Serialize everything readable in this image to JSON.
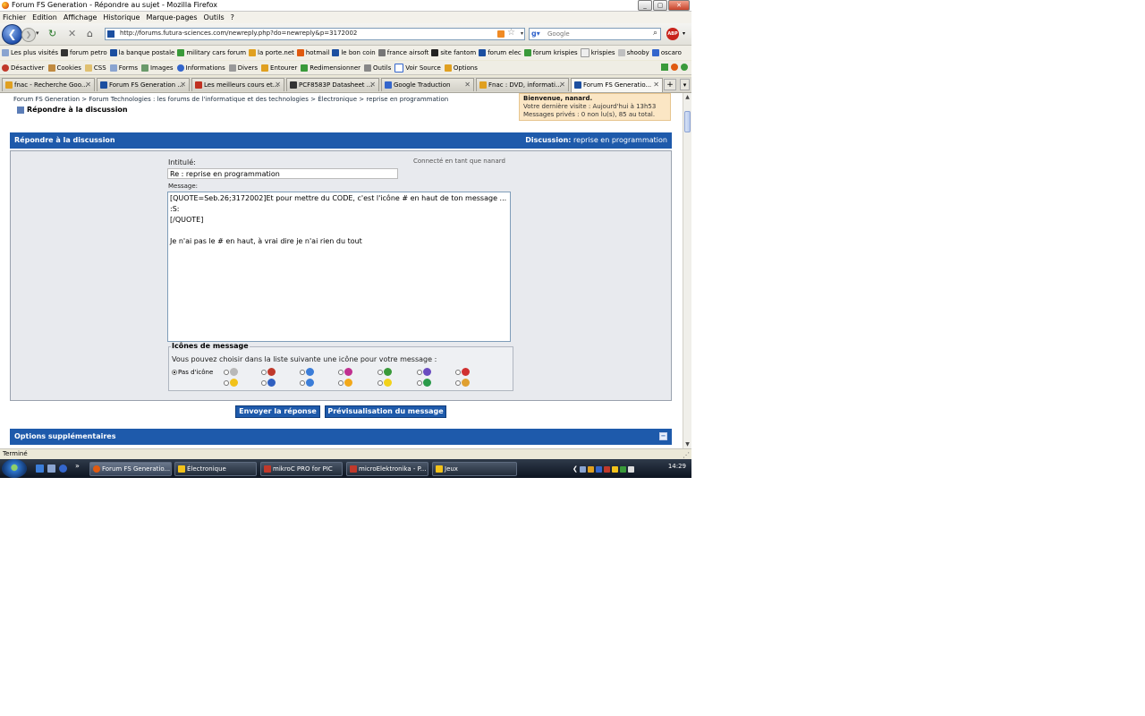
{
  "window": {
    "title": "Forum FS Generation - Répondre au sujet - Mozilla Firefox",
    "controls": [
      "_",
      "▢",
      "✕"
    ]
  },
  "menu": [
    "Fichier",
    "Edition",
    "Affichage",
    "Historique",
    "Marque-pages",
    "Outils",
    "?"
  ],
  "nav": {
    "url": "http://forums.futura-sciences.com/newreply.php?do=newreply&p=3172002",
    "search_placeholder": "Google"
  },
  "bookmarks": [
    "Les plus visités",
    "forum petro",
    "la banque postale",
    "military cars forum",
    "la porte.net",
    "hotmail",
    "le bon coin",
    "france airsoft",
    "site fantom",
    "forum elec",
    "forum krispies",
    "krispies",
    "shooby",
    "oscaro"
  ],
  "devbar": [
    "Désactiver",
    "Cookies",
    "CSS",
    "Forms",
    "Images",
    "Informations",
    "Divers",
    "Entourer",
    "Redimensionner",
    "Outils",
    "Voir Source",
    "Options"
  ],
  "tabs": [
    {
      "label": "fnac - Recherche Goo...",
      "color": "#e0a020"
    },
    {
      "label": "Forum FS Generation ...",
      "color": "#1c4fa0"
    },
    {
      "label": "Les meilleurs cours et...",
      "color": "#c03020"
    },
    {
      "label": "PCF8583P Datasheet ...",
      "color": "#333333"
    },
    {
      "label": "Google Traduction",
      "color": "#3466cc"
    },
    {
      "label": "Fnac : DVD, informati...",
      "color": "#e0a020"
    },
    {
      "label": "Forum FS Generatio...",
      "color": "#1c4fa0"
    }
  ],
  "page": {
    "breadcrumb": "Forum FS Generation > Forum Technologies : les forums de l'informatique et des technologies > Électronique > reprise en programmation",
    "title": "Répondre à la discussion",
    "welcome": {
      "greeting": "Bienvenue, nanard.",
      "last_visit": "Votre dernière visite : Aujourd'hui à 13h53",
      "private": "Messages privés : 0 non lu(s), 85 au total."
    },
    "panel": {
      "heading": "Répondre à la discussion",
      "discussion_label": "Discussion:",
      "discussion_value": "reprise en programmation"
    },
    "form": {
      "title_label": "Intitulé:",
      "title_value": "Re : reprise en programmation",
      "logged_as": "Connecté en tant que nanard",
      "message_label": "Message:",
      "message_value": "[QUOTE=Seb.26;3172002]Et pour mettre du CODE, c'est l'icône # en haut de ton message ... :S:\n[/QUOTE]\n\nJe n'ai pas le # en haut, à vrai dire je n'ai rien du tout"
    },
    "message_icons": {
      "legend": "Icônes de message",
      "hint": "Vous pouvez choisir dans la liste suivante une icône pour votre message :",
      "none_label": "Pas d'icône",
      "icons": [
        {
          "name": "icon-1",
          "color": "#b8b8b8"
        },
        {
          "name": "icon-2",
          "color": "#c0392b"
        },
        {
          "name": "icon-3",
          "color": "#3b7dd8"
        },
        {
          "name": "icon-4",
          "color": "#c03090"
        },
        {
          "name": "icon-5",
          "color": "#3a9a3a"
        },
        {
          "name": "icon-6",
          "color": "#6a4cc0"
        },
        {
          "name": "icon-7",
          "color": "#d03030"
        },
        {
          "name": "icon-8",
          "color": "#f2c21a"
        },
        {
          "name": "icon-9",
          "color": "#3060c0"
        },
        {
          "name": "icon-10",
          "color": "#3b7dd8"
        },
        {
          "name": "icon-11",
          "color": "#f2a81a"
        },
        {
          "name": "icon-12",
          "color": "#f2d21a"
        },
        {
          "name": "icon-13",
          "color": "#2a9a4a"
        },
        {
          "name": "icon-14",
          "color": "#e0a030"
        }
      ]
    },
    "buttons": {
      "submit": "Envoyer la réponse",
      "preview": "Prévisualisation du message"
    },
    "options_heading": "Options supplémentaires"
  },
  "status": "Terminé",
  "taskbar": {
    "tasks": [
      {
        "label": "Forum FS Generatio...",
        "color": "#e05a10",
        "active": true
      },
      {
        "label": "Électronique",
        "color": "#f2c21a",
        "active": false
      },
      {
        "label": "mikroC PRO for PIC",
        "color": "#c0392b",
        "active": false
      },
      {
        "label": "microElektronika - P...",
        "color": "#c0392b",
        "active": false
      },
      {
        "label": "Jeux",
        "color": "#f2c21a",
        "active": false
      }
    ],
    "clock": "14:29"
  }
}
